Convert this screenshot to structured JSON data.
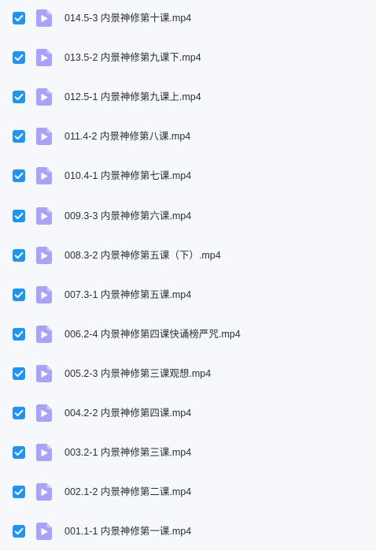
{
  "colors": {
    "checkbox_fill": "#1e95f6",
    "checkmark": "#ffffff",
    "video_icon_body": "#a7a3fb",
    "video_icon_fold": "#c9c6fd",
    "video_icon_play": "#ffffff",
    "background": "#f7f8fc",
    "text": "#2a2f3a"
  },
  "icons": {
    "checkbox": "checkbox-checked-icon",
    "file": "video-file-icon"
  },
  "files": [
    {
      "name": "014.5-3 内景神修第十课.mp4",
      "checked": true
    },
    {
      "name": "013.5-2 内景神修第九课下.mp4",
      "checked": true
    },
    {
      "name": "012.5-1 内景神修第九课上.mp4",
      "checked": true
    },
    {
      "name": "011.4-2 内景神修第八课.mp4",
      "checked": true
    },
    {
      "name": "010.4-1 内景神修第七课.mp4",
      "checked": true
    },
    {
      "name": "009.3-3 内景神修第六课.mp4",
      "checked": true
    },
    {
      "name": "008.3-2 内景神修第五课（下）.mp4",
      "checked": true
    },
    {
      "name": "007.3-1 内景神修第五课.mp4",
      "checked": true
    },
    {
      "name": "006.2-4 内景神修第四课快诵榜严咒.mp4",
      "checked": true
    },
    {
      "name": "005.2-3 内景神修第三课观想.mp4",
      "checked": true
    },
    {
      "name": "004.2-2 内景神修第四课.mp4",
      "checked": true
    },
    {
      "name": "003.2-1 内景神修第三课.mp4",
      "checked": true
    },
    {
      "name": "002.1-2 内景神修第二课.mp4",
      "checked": true
    },
    {
      "name": "001.1-1 内景神修第一课.mp4",
      "checked": true
    }
  ]
}
